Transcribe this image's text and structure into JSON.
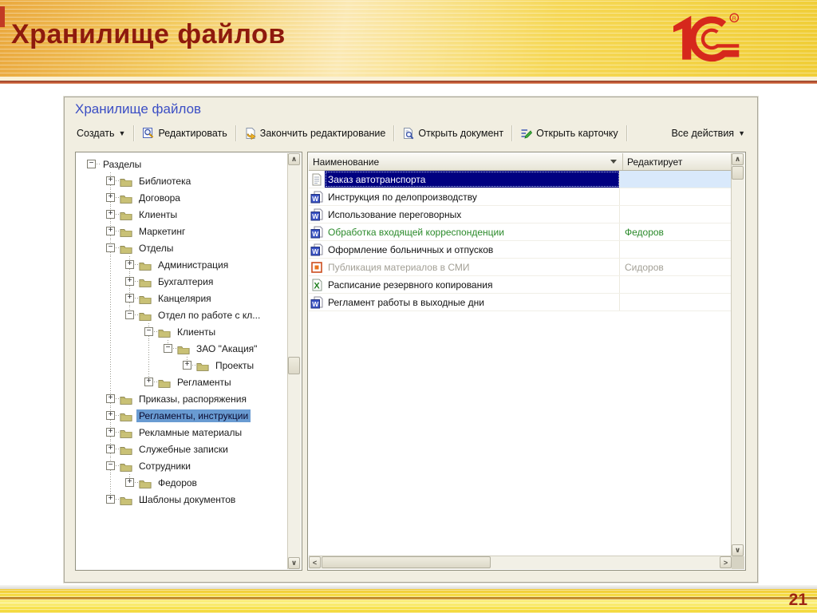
{
  "slide": {
    "title": "Хранилище файлов",
    "page_number": "21"
  },
  "logo": {
    "text": "1С",
    "registered": "®"
  },
  "window": {
    "title": "Хранилище файлов",
    "toolbar": {
      "buttons": [
        {
          "id": "create-button",
          "label": "Создать",
          "dropdown": true
        },
        {
          "id": "edit-button",
          "label": "Редактировать",
          "icon": "edit-document-icon"
        },
        {
          "id": "finish-editing-button",
          "label": "Закончить редактирование",
          "icon": "finish-editing-icon"
        },
        {
          "id": "open-document-button",
          "label": "Открыть документ",
          "icon": "open-document-icon"
        },
        {
          "id": "open-card-button",
          "label": "Открыть карточку",
          "icon": "open-card-icon"
        },
        {
          "id": "all-actions-button",
          "label": "Все действия",
          "dropdown": true,
          "align": "right"
        }
      ]
    },
    "tree": {
      "items": [
        {
          "label": "Разделы",
          "level": 0,
          "state": "expanded",
          "root": true
        },
        {
          "label": "Библиотека",
          "level": 1,
          "state": "collapsed"
        },
        {
          "label": "Договора",
          "level": 1,
          "state": "collapsed"
        },
        {
          "label": "Клиенты",
          "level": 1,
          "state": "collapsed"
        },
        {
          "label": "Маркетинг",
          "level": 1,
          "state": "collapsed"
        },
        {
          "label": "Отделы",
          "level": 1,
          "state": "expanded"
        },
        {
          "label": "Администрация",
          "level": 2,
          "state": "collapsed"
        },
        {
          "label": "Бухгалтерия",
          "level": 2,
          "state": "collapsed"
        },
        {
          "label": "Канцелярия",
          "level": 2,
          "state": "collapsed"
        },
        {
          "label": "Отдел по работе с кл...",
          "level": 2,
          "state": "expanded"
        },
        {
          "label": "Клиенты",
          "level": 3,
          "state": "expanded"
        },
        {
          "label": "ЗАО \"Акация\"",
          "level": 4,
          "state": "expanded"
        },
        {
          "label": "Проекты",
          "level": 5,
          "state": "collapsed"
        },
        {
          "label": "Регламенты",
          "level": 3,
          "state": "collapsed"
        },
        {
          "label": "Приказы, распоряжения",
          "level": 1,
          "state": "collapsed"
        },
        {
          "label": "Регламенты, инструкции",
          "level": 1,
          "state": "collapsed",
          "selected": true
        },
        {
          "label": "Рекламные материалы",
          "level": 1,
          "state": "collapsed"
        },
        {
          "label": "Служебные записки",
          "level": 1,
          "state": "collapsed"
        },
        {
          "label": "Сотрудники",
          "level": 1,
          "state": "expanded"
        },
        {
          "label": "Федоров",
          "level": 2,
          "state": "collapsed"
        },
        {
          "label": "Шаблоны документов",
          "level": 1,
          "state": "collapsed"
        }
      ]
    },
    "table": {
      "columns": [
        {
          "label": "Наименование",
          "sort": "desc"
        },
        {
          "label": "Редактирует"
        }
      ],
      "rows": [
        {
          "icon": "text-document-icon",
          "name": "Заказ автотранспорта",
          "editor": "",
          "state": "selected"
        },
        {
          "icon": "word-icon",
          "name": "Инструкция по делопроизводству",
          "editor": "",
          "state": "normal"
        },
        {
          "icon": "word-icon",
          "name": "Использование переговорных",
          "editor": "",
          "state": "normal"
        },
        {
          "icon": "word-icon",
          "name": "Обработка входящей корреспонденции",
          "editor": "Федоров",
          "state": "editing"
        },
        {
          "icon": "word-icon",
          "name": "Оформление больничных и отпусков",
          "editor": "",
          "state": "normal"
        },
        {
          "icon": "media-icon",
          "name": "Публикация материалов в СМИ",
          "editor": "Сидоров",
          "state": "locked"
        },
        {
          "icon": "excel-icon",
          "name": "Расписание резервного копирования",
          "editor": "",
          "state": "normal"
        },
        {
          "icon": "word-icon",
          "name": "Регламент работы в выходные дни",
          "editor": "",
          "state": "normal"
        }
      ]
    }
  },
  "colors": {
    "slide_title": "#8e1a0d",
    "logo_red": "#d6281c",
    "window_title": "#3b4ec4",
    "selection_navy": "#000080",
    "selection_cell": "#d9e9fb",
    "tree_selection": "#699bd2",
    "editing_green": "#2a8a2a",
    "locked_gray": "#a3a096"
  }
}
